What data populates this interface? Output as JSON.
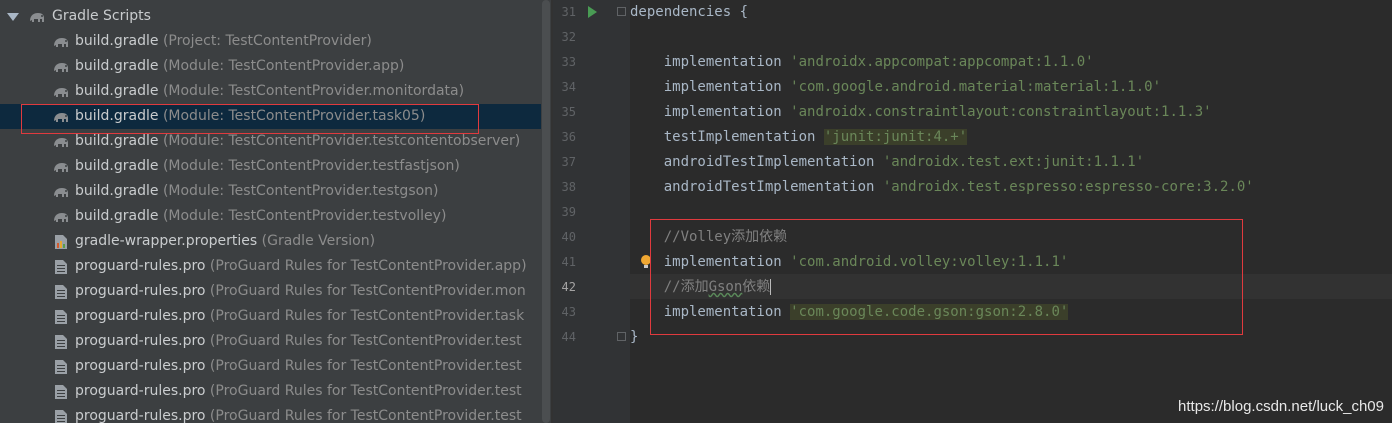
{
  "project_tree": {
    "root": {
      "label": "Gradle Scripts",
      "icon": "gradle-elephant-icon"
    },
    "items": [
      {
        "name": "build.gradle",
        "hint": "(Project: TestContentProvider)",
        "icon": "gradle-elephant-icon"
      },
      {
        "name": "build.gradle",
        "hint": "(Module: TestContentProvider.app)",
        "icon": "gradle-elephant-icon"
      },
      {
        "name": "build.gradle",
        "hint": "(Module: TestContentProvider.monitordata)",
        "icon": "gradle-elephant-icon"
      },
      {
        "name": "build.gradle",
        "hint": "(Module: TestContentProvider.task05)",
        "icon": "gradle-elephant-icon",
        "selected": true
      },
      {
        "name": "build.gradle",
        "hint": "(Module: TestContentProvider.testcontentobserver)",
        "icon": "gradle-elephant-icon"
      },
      {
        "name": "build.gradle",
        "hint": "(Module: TestContentProvider.testfastjson)",
        "icon": "gradle-elephant-icon"
      },
      {
        "name": "build.gradle",
        "hint": "(Module: TestContentProvider.testgson)",
        "icon": "gradle-elephant-icon"
      },
      {
        "name": "build.gradle",
        "hint": "(Module: TestContentProvider.testvolley)",
        "icon": "gradle-elephant-icon"
      },
      {
        "name": "gradle-wrapper.properties",
        "hint": "(Gradle Version)",
        "icon": "properties-file-icon"
      },
      {
        "name": "proguard-rules.pro",
        "hint": "(ProGuard Rules for TestContentProvider.app)",
        "icon": "text-file-icon"
      },
      {
        "name": "proguard-rules.pro",
        "hint": "(ProGuard Rules for TestContentProvider.mon",
        "icon": "text-file-icon"
      },
      {
        "name": "proguard-rules.pro",
        "hint": "(ProGuard Rules for TestContentProvider.task",
        "icon": "text-file-icon"
      },
      {
        "name": "proguard-rules.pro",
        "hint": "(ProGuard Rules for TestContentProvider.test",
        "icon": "text-file-icon"
      },
      {
        "name": "proguard-rules.pro",
        "hint": "(ProGuard Rules for TestContentProvider.test",
        "icon": "text-file-icon"
      },
      {
        "name": "proguard-rules.pro",
        "hint": "(ProGuard Rules for TestContentProvider.test",
        "icon": "text-file-icon"
      },
      {
        "name": "proguard-rules.pro",
        "hint": "(ProGuard Rules for TestContentProvider.test",
        "icon": "text-file-icon"
      }
    ]
  },
  "editor": {
    "current_line": "42",
    "lines": [
      {
        "n": "31",
        "indent": "",
        "keyword": "dependencies {",
        "string": ""
      },
      {
        "n": "32",
        "indent": "",
        "keyword": "",
        "string": ""
      },
      {
        "n": "33",
        "indent": "    ",
        "keyword": "implementation ",
        "string": "'androidx.appcompat:appcompat:1.1.0'"
      },
      {
        "n": "34",
        "indent": "    ",
        "keyword": "implementation ",
        "string": "'com.google.android.material:material:1.1.0'"
      },
      {
        "n": "35",
        "indent": "    ",
        "keyword": "implementation ",
        "string": "'androidx.constraintlayout:constraintlayout:1.1.3'"
      },
      {
        "n": "36",
        "indent": "    ",
        "keyword": "testImplementation ",
        "string": "'junit:junit:4.+'"
      },
      {
        "n": "37",
        "indent": "    ",
        "keyword": "androidTestImplementation ",
        "string": "'androidx.test.ext:junit:1.1.1'"
      },
      {
        "n": "38",
        "indent": "    ",
        "keyword": "androidTestImplementation ",
        "string": "'androidx.test.espresso:espresso-core:3.2.0'"
      },
      {
        "n": "39",
        "indent": "",
        "keyword": "",
        "string": ""
      },
      {
        "n": "40",
        "indent": "    ",
        "comment": "//Volley添加依赖"
      },
      {
        "n": "41",
        "indent": "    ",
        "keyword": "implementation ",
        "string": "'com.android.volley:volley:1.1.1'"
      },
      {
        "n": "42",
        "indent": "    ",
        "comment_prefix": "//添加",
        "comment_wavy": "Gson",
        "comment_suffix": "依赖"
      },
      {
        "n": "43",
        "indent": "    ",
        "keyword": "implementation ",
        "string": "'com.google.code.gson:gson:2.8.0'"
      },
      {
        "n": "44",
        "indent": "",
        "keyword": "}",
        "string": ""
      }
    ]
  },
  "colors": {
    "annotation_box": "#e03a3e",
    "string": "#6a8759",
    "keyword": "#a9b7c6",
    "comment": "#808080"
  },
  "watermark": "https://blog.csdn.net/luck_ch09"
}
